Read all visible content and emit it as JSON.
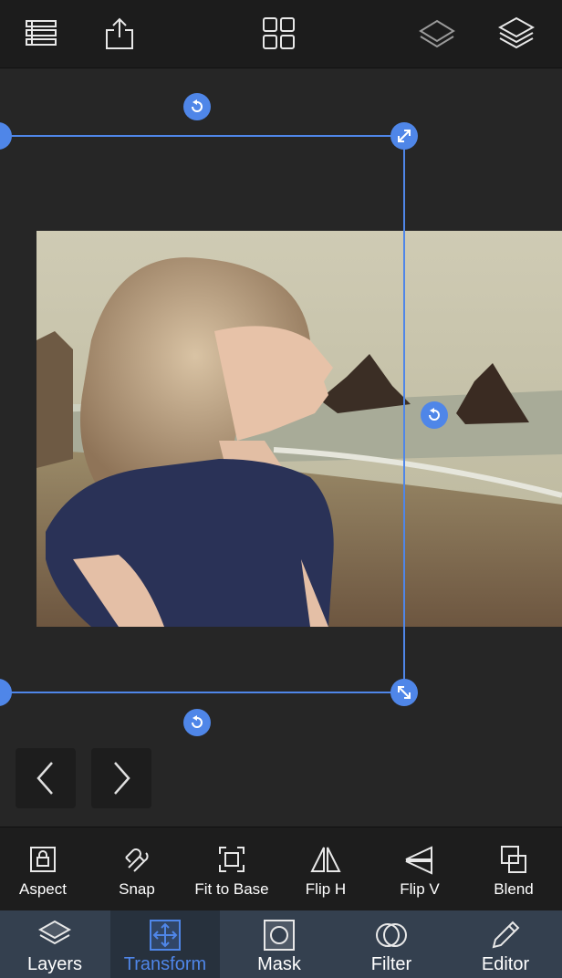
{
  "top_bar": {
    "icons": [
      "list-icon",
      "share-icon",
      "grid-icon",
      "layers-single-icon",
      "layers-stack-icon"
    ]
  },
  "canvas": {
    "image_description_icon": "photo-layer",
    "prev_icon": "chevron-left-icon",
    "next_icon": "chevron-right-icon"
  },
  "toolbar": {
    "items": [
      {
        "label": "Aspect",
        "icon": "lock-icon"
      },
      {
        "label": "Snap",
        "icon": "magnet-icon"
      },
      {
        "label": "Fit to Base",
        "icon": "fit-frame-icon"
      },
      {
        "label": "Flip H",
        "icon": "flip-horizontal-icon"
      },
      {
        "label": "Flip V",
        "icon": "flip-vertical-icon"
      },
      {
        "label": "Blend",
        "icon": "blend-icon"
      }
    ]
  },
  "tabs": {
    "items": [
      {
        "label": "Layers",
        "icon": "layers-icon",
        "active": false
      },
      {
        "label": "Transform",
        "icon": "transform-icon",
        "active": true
      },
      {
        "label": "Mask",
        "icon": "mask-icon",
        "active": false
      },
      {
        "label": "Filter",
        "icon": "filter-icon",
        "active": false
      },
      {
        "label": "Editor",
        "icon": "pencil-icon",
        "active": false
      }
    ]
  },
  "colors": {
    "accent": "#4f86e8",
    "tabbar_bg": "#34404f",
    "toolbar_bg": "#1d1d1d"
  }
}
